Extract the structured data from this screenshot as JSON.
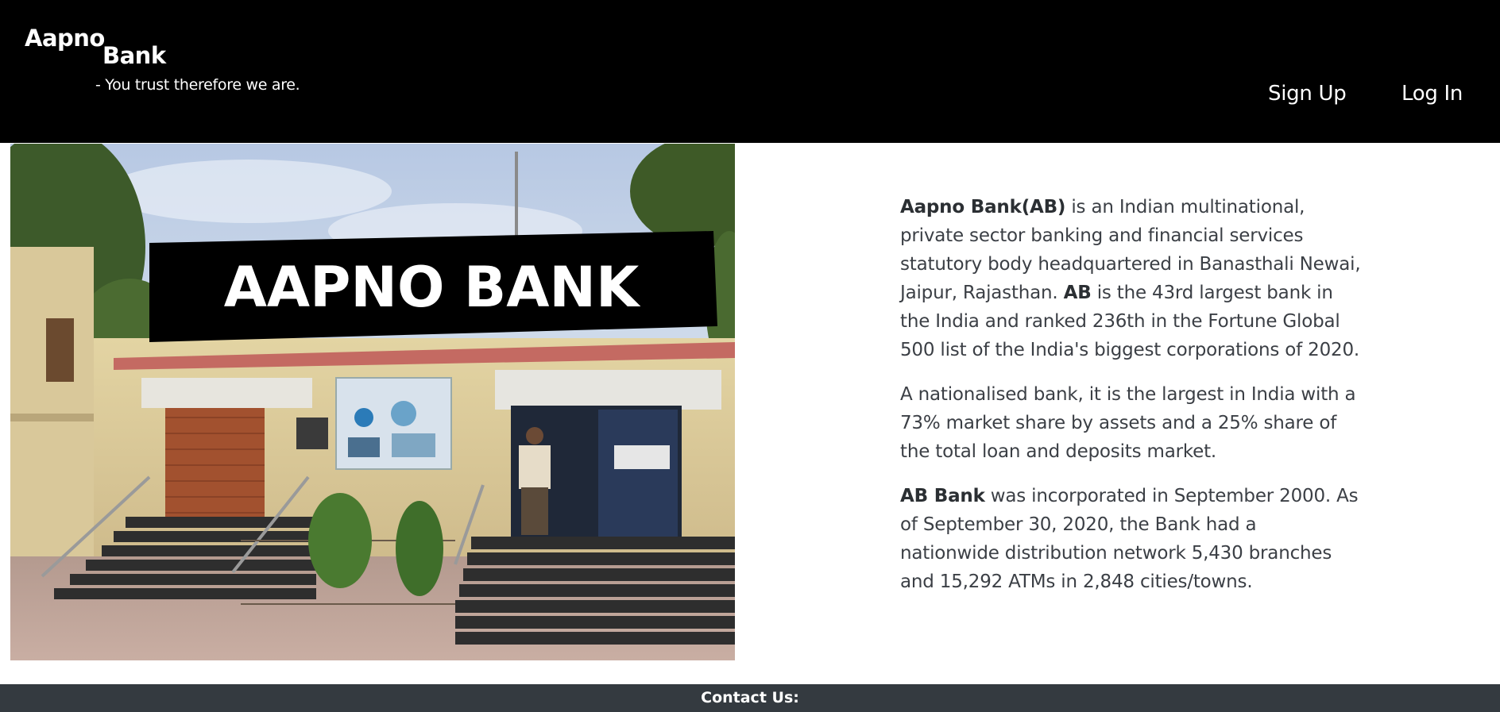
{
  "header": {
    "brand_line1": "Aapno",
    "brand_line2": "Bank",
    "tagline": "- You trust therefore we are.",
    "nav": {
      "signup_label": "Sign Up",
      "login_label": "Log In"
    }
  },
  "hero_image": {
    "signboard_text": "AAPNO BANK"
  },
  "about": {
    "p1": {
      "bold1": "Aapno Bank(AB)",
      "text1": " is an Indian multinational, private sector banking and financial services statutory body headquartered in Banasthali Newai, Jaipur, Rajasthan. ",
      "bold2": "AB",
      "text2": " is the 43rd largest bank in the India and ranked 236th in the Fortune Global 500 list of the India's biggest corporations of 2020."
    },
    "p2": {
      "text": "A nationalised bank, it is the largest in India with a 73% market share by assets and a 25% share of the total loan and deposits market."
    },
    "p3": {
      "bold": "AB Bank",
      "text": " was incorporated in September 2000. As of September 30, 2020, the Bank had a nationwide distribution network 5,430 branches and 15,292 ATMs in 2,848 cities/towns."
    }
  },
  "footer": {
    "title": "Contact Us:"
  },
  "colors": {
    "header_bg": "#000000",
    "footer_bg": "#343a40",
    "body_text": "#3b3f45"
  }
}
